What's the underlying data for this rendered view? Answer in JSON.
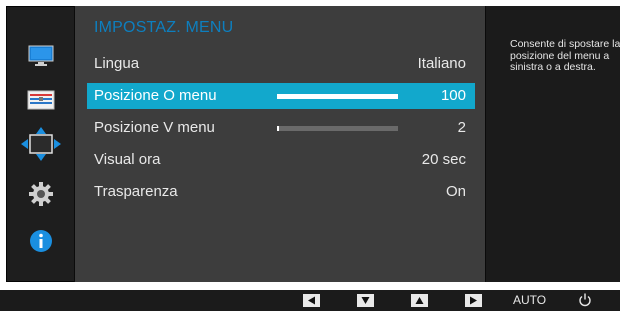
{
  "menu": {
    "title": "IMPOSTAZ. MENU",
    "items": [
      {
        "label": "Lingua",
        "value": "Italiano"
      },
      {
        "label": "Posizione O menu",
        "value": "100",
        "level": 1.0,
        "selected": true
      },
      {
        "label": "Posizione V menu",
        "value": "2",
        "level": 0.02
      },
      {
        "label": "Visual ora",
        "value": "20 sec"
      },
      {
        "label": "Trasparenza",
        "value": "On"
      }
    ]
  },
  "help": {
    "text": "Consente di spostare la posizione del menu a sinistra o a destra."
  },
  "sidebar": {
    "icons": [
      "monitor-icon",
      "settings-bars-icon",
      "position-arrows-icon",
      "gear-icon",
      "info-icon"
    ]
  },
  "bottom_bar": {
    "buttons": [
      "left-arrow-icon",
      "down-arrow-icon",
      "up-arrow-icon",
      "right-arrow-icon"
    ],
    "auto_label": "AUTO",
    "power_icon": "power-icon"
  },
  "colors": {
    "accent": "#12a8cc",
    "title": "#0d7fbf"
  }
}
